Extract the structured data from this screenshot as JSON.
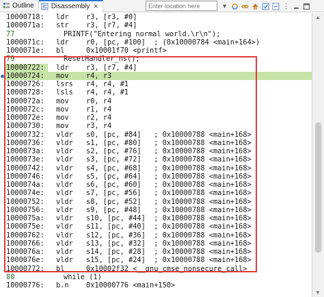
{
  "tabs": [
    {
      "label": "Outline",
      "icon": "outline-icon",
      "active": false
    },
    {
      "label": "Disassembly",
      "icon": "disassembly-icon",
      "active": true
    }
  ],
  "location": {
    "placeholder": "Enter location here"
  },
  "toolbar": [
    {
      "icon": "dropdown-icon"
    },
    {
      "icon": "sync-icon"
    },
    {
      "icon": "link-icon"
    },
    {
      "icon": "home-icon"
    },
    {
      "icon": "filter-icon"
    },
    {
      "icon": "collapse-icon"
    },
    {
      "icon": "view-menu-icon"
    },
    {
      "icon": "minimize-icon"
    },
    {
      "icon": "maximize-icon"
    }
  ],
  "lines": [
    {
      "kind": "asm",
      "addr": "10000718:",
      "ins": "ldr",
      "ops": "r3, [r3, #0]"
    },
    {
      "kind": "asm",
      "addr": "1000071a:",
      "ins": "str",
      "ops": "r3, [r7, #4]"
    },
    {
      "kind": "src",
      "no": "77",
      "text": "PRINTF(\"Entering normal world.\\r\\n\");"
    },
    {
      "kind": "asm",
      "addr": "1000071c:",
      "ins": "ldr",
      "ops": "r0, [pc, #100]  ; (0x10000784 <main+164>)"
    },
    {
      "kind": "asm",
      "addr": "1000071e:",
      "ins": "bl",
      "ops": "0x10001f70 <printf>"
    },
    {
      "kind": "src",
      "no": "79",
      "text": "ResetHandler_ns();"
    },
    {
      "kind": "asm",
      "addr": "10000722:",
      "ins": "ldr",
      "ops": "r3, [r7, #4]",
      "hl": "addr"
    },
    {
      "kind": "asm",
      "addr": "10000724:",
      "ins": "mov",
      "ops": "r4, r3",
      "hl": "row"
    },
    {
      "kind": "asm",
      "addr": "10000726:",
      "ins": "lsrs",
      "ops": "r4, r4, #1"
    },
    {
      "kind": "asm",
      "addr": "10000728:",
      "ins": "lsls",
      "ops": "r4, r4, #1"
    },
    {
      "kind": "asm",
      "addr": "1000072a:",
      "ins": "mov",
      "ops": "r0, r4"
    },
    {
      "kind": "asm",
      "addr": "1000072c:",
      "ins": "mov",
      "ops": "r1, r4"
    },
    {
      "kind": "asm",
      "addr": "1000072e:",
      "ins": "mov",
      "ops": "r2, r4"
    },
    {
      "kind": "asm",
      "addr": "10000730:",
      "ins": "mov",
      "ops": "r3, r4"
    },
    {
      "kind": "asm",
      "addr": "10000732:",
      "ins": "vldr",
      "ops": "s0, [pc, #84]   ; 0x10000788 <main+168>"
    },
    {
      "kind": "asm",
      "addr": "10000736:",
      "ins": "vldr",
      "ops": "s1, [pc, #80]   ; 0x10000788 <main+168>"
    },
    {
      "kind": "asm",
      "addr": "1000073a:",
      "ins": "vldr",
      "ops": "s2, [pc, #76]   ; 0x10000788 <main+168>"
    },
    {
      "kind": "asm",
      "addr": "1000073e:",
      "ins": "vldr",
      "ops": "s3, [pc, #72]   ; 0x10000788 <main+168>"
    },
    {
      "kind": "asm",
      "addr": "10000742:",
      "ins": "vldr",
      "ops": "s4, [pc, #68]   ; 0x10000788 <main+168>"
    },
    {
      "kind": "asm",
      "addr": "10000746:",
      "ins": "vldr",
      "ops": "s5, [pc, #64]   ; 0x10000788 <main+168>"
    },
    {
      "kind": "asm",
      "addr": "1000074a:",
      "ins": "vldr",
      "ops": "s6, [pc, #60]   ; 0x10000788 <main+168>"
    },
    {
      "kind": "asm",
      "addr": "1000074e:",
      "ins": "vldr",
      "ops": "s7, [pc, #56]   ; 0x10000788 <main+168>"
    },
    {
      "kind": "asm",
      "addr": "10000752:",
      "ins": "vldr",
      "ops": "s8, [pc, #52]   ; 0x10000788 <main+168>"
    },
    {
      "kind": "asm",
      "addr": "10000756:",
      "ins": "vldr",
      "ops": "s9, [pc, #48]   ; 0x10000788 <main+168>"
    },
    {
      "kind": "asm",
      "addr": "1000075a:",
      "ins": "vldr",
      "ops": "s10, [pc, #44]  ; 0x10000788 <main+168>"
    },
    {
      "kind": "asm",
      "addr": "1000075e:",
      "ins": "vldr",
      "ops": "s11, [pc, #40]  ; 0x10000788 <main+168>"
    },
    {
      "kind": "asm",
      "addr": "10000762:",
      "ins": "vldr",
      "ops": "s12, [pc, #36]  ; 0x10000788 <main+168>"
    },
    {
      "kind": "asm",
      "addr": "10000766:",
      "ins": "vldr",
      "ops": "s13, [pc, #32]  ; 0x10000788 <main+168>"
    },
    {
      "kind": "asm",
      "addr": "1000076a:",
      "ins": "vldr",
      "ops": "s14, [pc, #28]  ; 0x10000788 <main+168>"
    },
    {
      "kind": "asm",
      "addr": "1000076e:",
      "ins": "vldr",
      "ops": "s15, [pc, #24]  ; 0x10000788 <main+168>"
    },
    {
      "kind": "asm",
      "addr": "10000772:",
      "ins": "bl",
      "ops": "0x10002f32 <__gnu_cmse_nonsecure_call>"
    },
    {
      "kind": "src",
      "no": "80",
      "text": "while (1)"
    },
    {
      "kind": "asm",
      "addr": "10000776:",
      "ins": "b.n",
      "ops": "0x10000776 <main+150>"
    }
  ]
}
